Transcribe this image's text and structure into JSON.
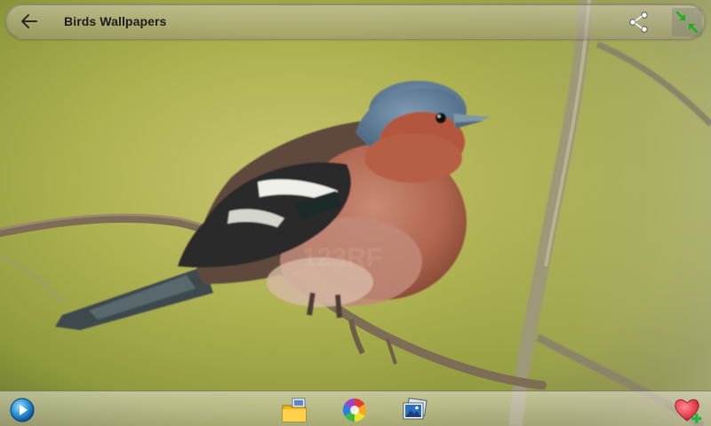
{
  "app": {
    "title": "Birds Wallpapers"
  },
  "topbar": {
    "back_icon": "arrow-left-icon",
    "share_icon": "share-icon",
    "fullscreen_icon": "fullscreen-toggle-icon",
    "fullscreen_color": "#18b41c"
  },
  "wallpaper": {
    "subject": "bird-on-branch",
    "background_color": "#a9b24c",
    "watermark": "123RF"
  },
  "bottombar": {
    "items": [
      {
        "icon": "slideshow-play-icon"
      },
      {
        "icon": "set-wallpaper-folder-icon"
      },
      {
        "icon": "color-wheel-icon"
      },
      {
        "icon": "gallery-photos-icon"
      },
      {
        "icon": "add-favorite-heart-icon"
      }
    ]
  }
}
